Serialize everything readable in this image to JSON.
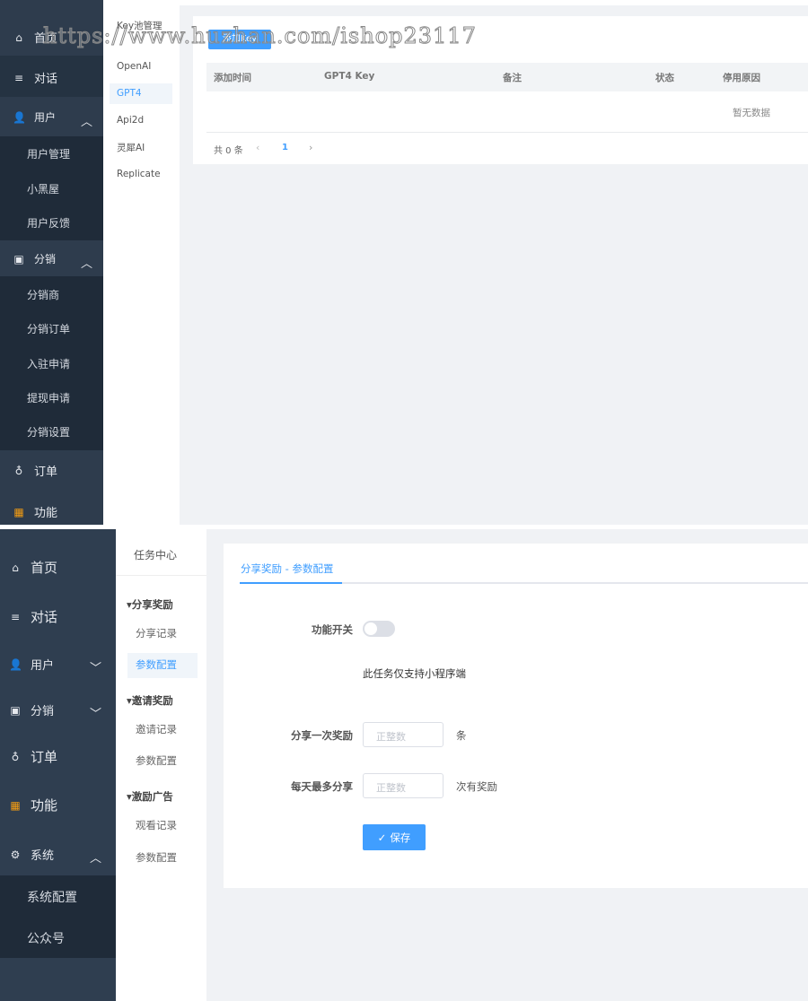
{
  "watermark": "https://www.huzhan.com/ishop23117",
  "top": {
    "sidebar": {
      "home": "首页",
      "chat": "对话",
      "user": "用户",
      "user_items": [
        "用户管理",
        "小黑屋",
        "用户反馈"
      ],
      "distribution": "分销",
      "dist_items": [
        "分销商",
        "分销订单",
        "入驻申请",
        "提现申请",
        "分销设置"
      ],
      "orders": "订单",
      "features": "功能"
    },
    "subnav": {
      "title": "Key池管理",
      "items": [
        "OpenAI",
        "GPT4",
        "Api2d",
        "灵犀AI",
        "Replicate"
      ],
      "active": "GPT4"
    },
    "add_button": "添加Key",
    "table": {
      "headers": [
        "添加时间",
        "GPT4 Key",
        "备注",
        "状态",
        "停用原因"
      ],
      "empty": "暂无数据"
    },
    "pagination": {
      "total": "共 0 条",
      "page": "1"
    }
  },
  "bottom": {
    "sidebar": {
      "home": "首页",
      "chat": "对话",
      "user": "用户",
      "distribution": "分销",
      "orders": "订单",
      "features": "功能",
      "system": "系统",
      "system_items": [
        "系统配置",
        "公众号"
      ]
    },
    "subnav": {
      "title": "任务中心",
      "groups": [
        {
          "label": "分享奖励",
          "items": [
            "分享记录",
            "参数配置"
          ]
        },
        {
          "label": "邀请奖励",
          "items": [
            "邀请记录",
            "参数配置"
          ]
        },
        {
          "label": "激励广告",
          "items": [
            "观看记录",
            "参数配置"
          ]
        }
      ]
    },
    "tab": "分享奖励 - 参数配置",
    "form": {
      "switch_label": "功能开关",
      "switch_on": false,
      "note": "此任务仅支持小程序端",
      "reward_label": "分享一次奖励",
      "reward_placeholder": "正整数",
      "reward_unit": "条",
      "max_label": "每天最多分享",
      "max_placeholder": "正整数",
      "max_unit": "次有奖励",
      "save": "保存"
    }
  },
  "colors": {
    "primary": "#409eff",
    "sidebar": "#2e3c4d",
    "active_text": "#409eff"
  }
}
